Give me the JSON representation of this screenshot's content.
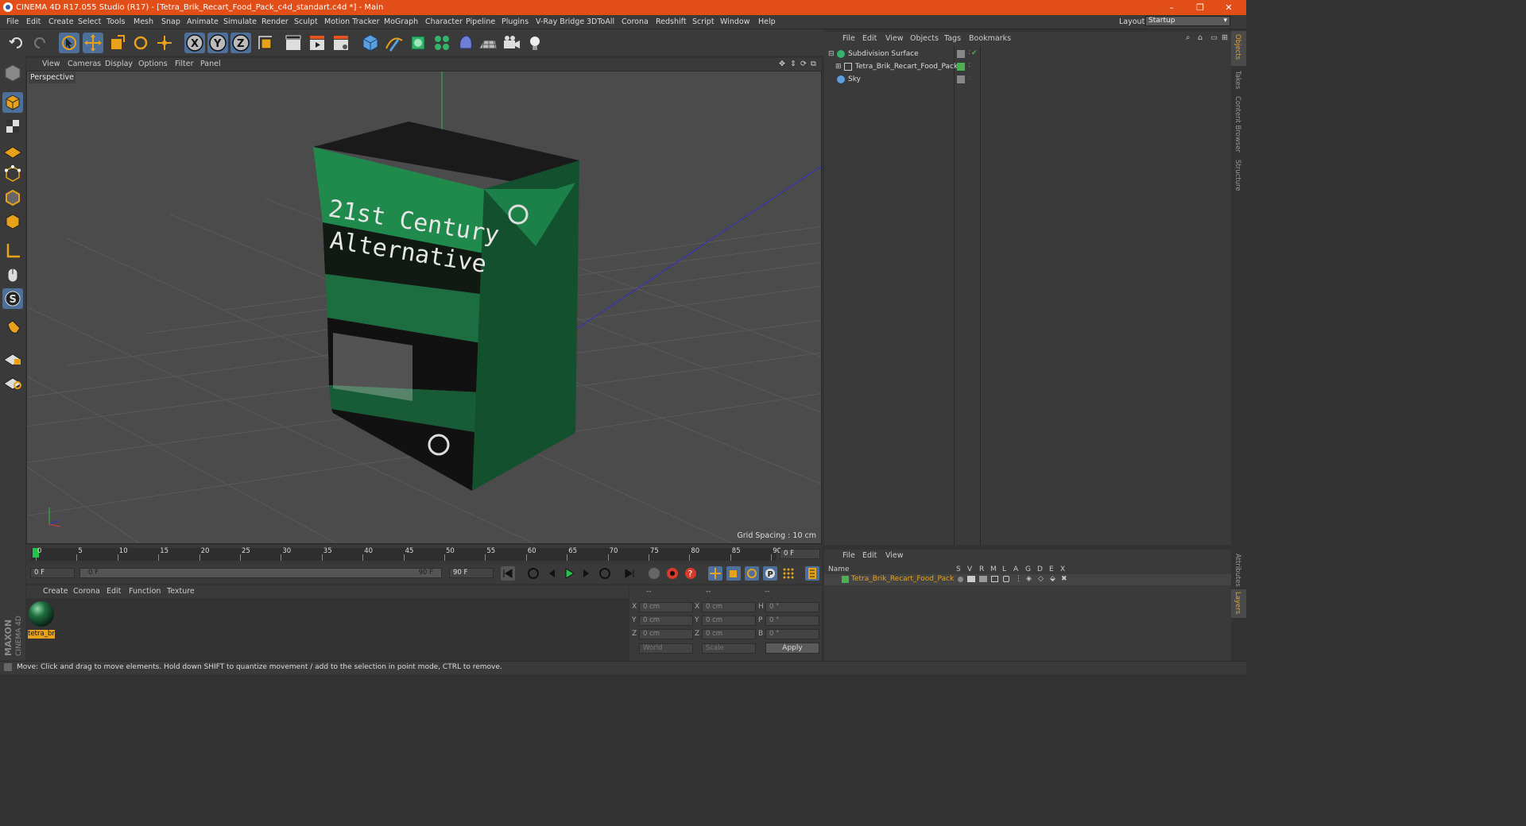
{
  "window": {
    "title": "CINEMA 4D R17.055 Studio (R17) - [Tetra_Brik_Recart_Food_Pack_c4d_standart.c4d *] - Main",
    "controls": {
      "minimize": "–",
      "maximize": "❐",
      "close": "✕"
    }
  },
  "menubar": {
    "items": [
      "File",
      "Edit",
      "Create",
      "Select",
      "Tools",
      "Mesh",
      "Snap",
      "Animate",
      "Simulate",
      "Render",
      "Sculpt",
      "Motion Tracker",
      "MoGraph",
      "Character",
      "Pipeline",
      "Plugins",
      "V-Ray Bridge",
      "3DToAll",
      "Corona",
      "Redshift",
      "Script",
      "Window",
      "Help"
    ],
    "layout_label": "Layout:",
    "layout_value": "Startup"
  },
  "viewport": {
    "menu": [
      "View",
      "Cameras",
      "Display",
      "Options",
      "Filter",
      "Panel"
    ],
    "camera": "Perspective",
    "grid_spacing": "Grid Spacing : 10 cm",
    "box_text": {
      "line1": "21st Century",
      "line2": "Alternative"
    }
  },
  "timeline": {
    "ticks": [
      "0",
      "5",
      "10",
      "15",
      "20",
      "25",
      "30",
      "35",
      "40",
      "45",
      "50",
      "55",
      "60",
      "65",
      "70",
      "75",
      "80",
      "85",
      "90"
    ],
    "current_frame": "0 F",
    "start_field": "0 F",
    "range_start": "0 F",
    "range_end": "90 F",
    "end_field": "90 F"
  },
  "material_manager": {
    "menu": [
      "Create",
      "Corona",
      "Edit",
      "Function",
      "Texture"
    ],
    "materials": [
      {
        "name": "tetra_br"
      }
    ]
  },
  "coordinates": {
    "headers": [
      "--",
      "--",
      "--"
    ],
    "rows": [
      {
        "axis": "X",
        "pos": "0 cm",
        "size_axis": "X",
        "size": "0 cm",
        "rot_axis": "H",
        "rot": "0 °"
      },
      {
        "axis": "Y",
        "pos": "0 cm",
        "size_axis": "Y",
        "size": "0 cm",
        "rot_axis": "P",
        "rot": "0 °"
      },
      {
        "axis": "Z",
        "pos": "0 cm",
        "size_axis": "Z",
        "size": "0 cm",
        "rot_axis": "B",
        "rot": "0 °"
      }
    ],
    "mode_select": "World",
    "scale_select": "Scale",
    "apply": "Apply"
  },
  "object_manager": {
    "menu": [
      "File",
      "Edit",
      "View",
      "Objects",
      "Tags",
      "Bookmarks"
    ],
    "objects": [
      {
        "name": "Subdivision Surface",
        "indent": 0
      },
      {
        "name": "Tetra_Brik_Recart_Food_Pack",
        "indent": 1
      },
      {
        "name": "Sky",
        "indent": 0
      }
    ]
  },
  "layer_manager": {
    "menu": [
      "File",
      "Edit",
      "View"
    ],
    "columns": {
      "name": "Name",
      "flags": [
        "S",
        "V",
        "R",
        "M",
        "L",
        "A",
        "G",
        "D",
        "E",
        "X"
      ]
    },
    "layers": [
      {
        "name": "Tetra_Brik_Recart_Food_Pack",
        "color": "#4caf50"
      }
    ]
  },
  "right_tabs": [
    "Objects",
    "Takes",
    "Content Browser",
    "Structure",
    "Attributes",
    "Layers"
  ],
  "brand": {
    "line1": "MAXON",
    "line2": "CINEMA 4D"
  },
  "status": "Move: Click and drag to move elements. Hold down SHIFT to quantize movement / add to the selection in point mode, CTRL to remove.",
  "colors": {
    "title_bar": "#e14e17",
    "selection_blue": "#4e6f9a",
    "accent_orange": "#e8a21a",
    "box_green": "#1f8a4c"
  }
}
